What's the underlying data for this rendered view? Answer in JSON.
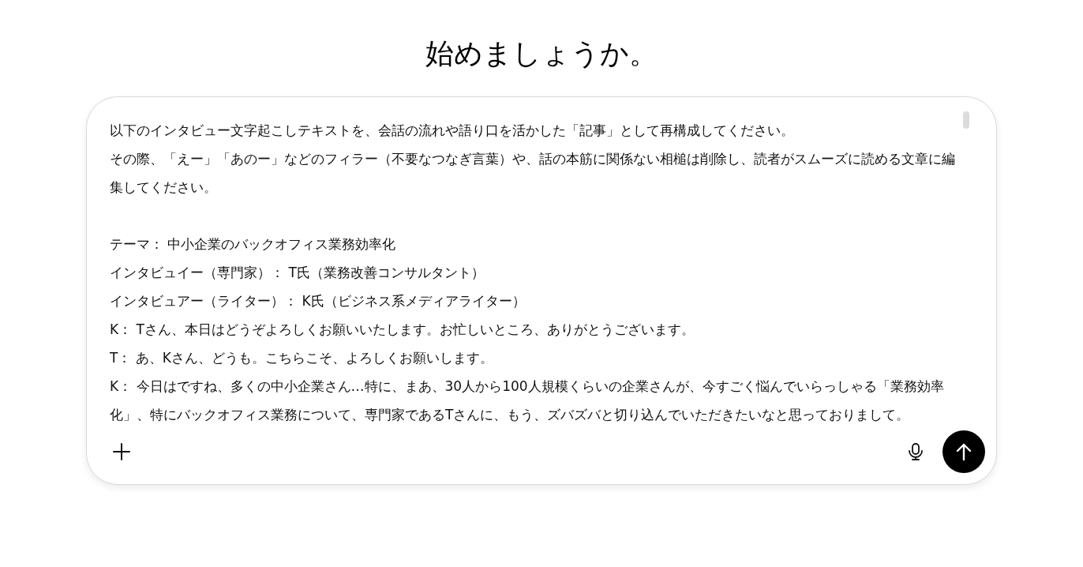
{
  "heading": "始めましょうか。",
  "composer": {
    "instructions": [
      "以下のインタビュー文字起こしテキストを、会話の流れや語り口を活かした「記事」として再構成してください。",
      "その際、「えー」「あのー」などのフィラー（不要なつなぎ言葉）や、話の本筋に関係ない相槌は削除し、読者がスムーズに読める文章に編集してください。"
    ],
    "transcript": [
      "テーマ： 中小企業のバックオフィス業務効率化",
      "インタビュイー（専門家）： T氏（業務改善コンサルタント）",
      "インタビュアー（ライター）： K氏（ビジネス系メディアライター）",
      "K： Tさん、本日はどうぞよろしくお願いいたします。お忙しいところ、ありがとうございます。",
      "T： あ、Kさん、どうも。こちらこそ、よろしくお願いします。",
      "K： 今日はですね、多くの中小企業さん…特に、まあ、30人から100人規模くらいの企業さんが、今すごく悩んでいらっしゃる「業務効率化」、特にバックオフィス業務について、専門家であるTさんに、もう、ズバズバと切り込んでいただきたいなと思っておりまして。"
    ]
  }
}
